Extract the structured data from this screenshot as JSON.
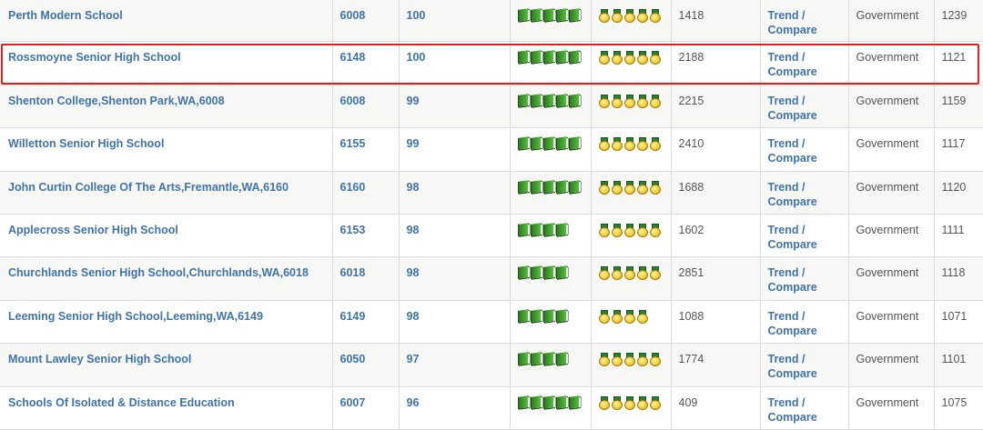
{
  "highlight_color": "#e81e1e",
  "link_color": "#3f74a9",
  "rows": [
    {
      "name": "Perth Modern School",
      "postcode": "6008",
      "score": "100",
      "books": 5,
      "medals": 5,
      "enrolments": "1418",
      "trend_line1": "Trend /",
      "trend_line2": "Compare",
      "sector": "Government",
      "icsea": "1239"
    },
    {
      "name": "Rossmoyne Senior High School",
      "postcode": "6148",
      "score": "100",
      "books": 5,
      "medals": 5,
      "enrolments": "2188",
      "trend_line1": "Trend /",
      "trend_line2": "Compare",
      "sector": "Government",
      "icsea": "1121"
    },
    {
      "name": "Shenton College,Shenton Park,WA,6008",
      "postcode": "6008",
      "score": "99",
      "books": 5,
      "medals": 5,
      "enrolments": "2215",
      "trend_line1": "Trend /",
      "trend_line2": "Compare",
      "sector": "Government",
      "icsea": "1159"
    },
    {
      "name": "Willetton Senior High School",
      "postcode": "6155",
      "score": "99",
      "books": 5,
      "medals": 5,
      "enrolments": "2410",
      "trend_line1": "Trend /",
      "trend_line2": "Compare",
      "sector": "Government",
      "icsea": "1117"
    },
    {
      "name": "John Curtin College Of The Arts,Fremantle,WA,6160",
      "postcode": "6160",
      "score": "98",
      "books": 5,
      "medals": 5,
      "enrolments": "1688",
      "trend_line1": "Trend /",
      "trend_line2": "Compare",
      "sector": "Government",
      "icsea": "1120"
    },
    {
      "name": "Applecross Senior High School",
      "postcode": "6153",
      "score": "98",
      "books": 4,
      "medals": 5,
      "enrolments": "1602",
      "trend_line1": "Trend /",
      "trend_line2": "Compare",
      "sector": "Government",
      "icsea": "1111"
    },
    {
      "name": "Churchlands Senior High School,Churchlands,WA,6018",
      "postcode": "6018",
      "score": "98",
      "books": 4,
      "medals": 5,
      "enrolments": "2851",
      "trend_line1": "Trend /",
      "trend_line2": "Compare",
      "sector": "Government",
      "icsea": "1118"
    },
    {
      "name": "Leeming Senior High School,Leeming,WA,6149",
      "postcode": "6149",
      "score": "98",
      "books": 4,
      "medals": 4,
      "enrolments": "1088",
      "trend_line1": "Trend /",
      "trend_line2": "Compare",
      "sector": "Government",
      "icsea": "1071"
    },
    {
      "name": "Mount Lawley Senior High School",
      "postcode": "6050",
      "score": "97",
      "books": 4,
      "medals": 5,
      "enrolments": "1774",
      "trend_line1": "Trend /",
      "trend_line2": "Compare",
      "sector": "Government",
      "icsea": "1101"
    },
    {
      "name": "Schools Of Isolated & Distance Education",
      "postcode": "6007",
      "score": "96",
      "books": 5,
      "medals": 5,
      "enrolments": "409",
      "trend_line1": "Trend /",
      "trend_line2": "Compare",
      "sector": "Government",
      "icsea": "1075"
    }
  ]
}
